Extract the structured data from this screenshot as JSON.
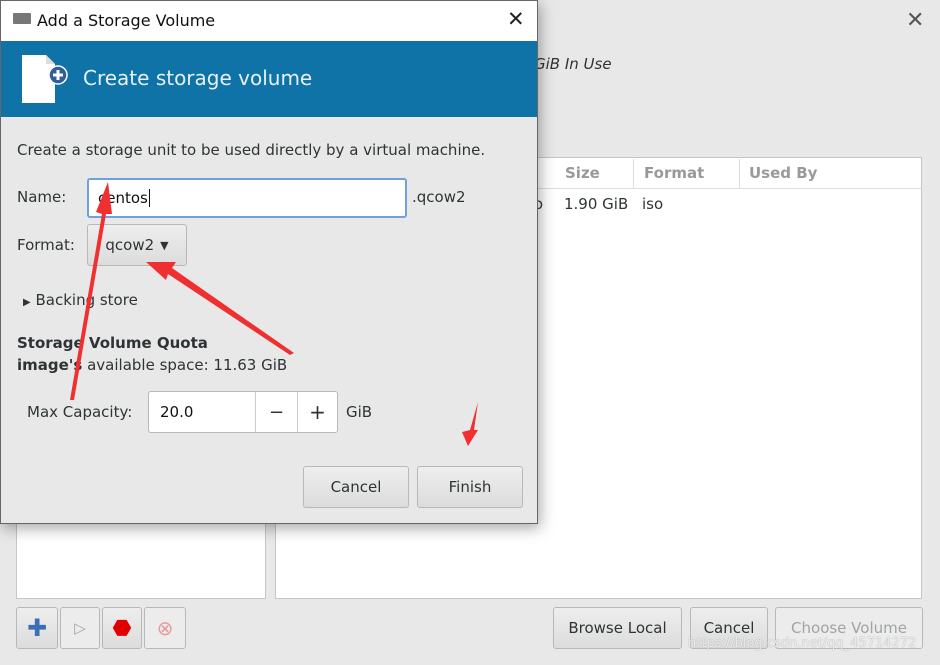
{
  "background_window": {
    "usage_text": "GiB In Use",
    "table": {
      "columns": [
        "Size",
        "Format",
        "Used By"
      ],
      "rows": [
        {
          "name_fragment": "so",
          "size": "1.90 GiB",
          "format": "iso",
          "used_by": ""
        }
      ]
    },
    "buttons": {
      "browse_local": "Browse Local",
      "cancel": "Cancel",
      "choose_volume": "Choose Volume"
    },
    "watermark": "https://blog.csdn.net/qq_45714272"
  },
  "dialog": {
    "title": "Add a Storage Volume",
    "banner_title": "Create storage volume",
    "description": "Create a storage unit to be used directly by a virtual machine.",
    "name_label": "Name:",
    "name_value": "centos",
    "name_suffix": ".qcow2",
    "format_label": "Format:",
    "format_value": "qcow2",
    "backing_store": "Backing store",
    "quota_title": "Storage Volume Quota",
    "quota_pool": "image's",
    "quota_text": "available space: 11.63 GiB",
    "capacity_label": "Max Capacity:",
    "capacity_value": "20.0",
    "capacity_unit": "GiB",
    "minus": "−",
    "plus": "+",
    "cancel": "Cancel",
    "finish": "Finish"
  },
  "colors": {
    "banner": "#0f73a8",
    "annotation_arrows": "#f03030"
  }
}
